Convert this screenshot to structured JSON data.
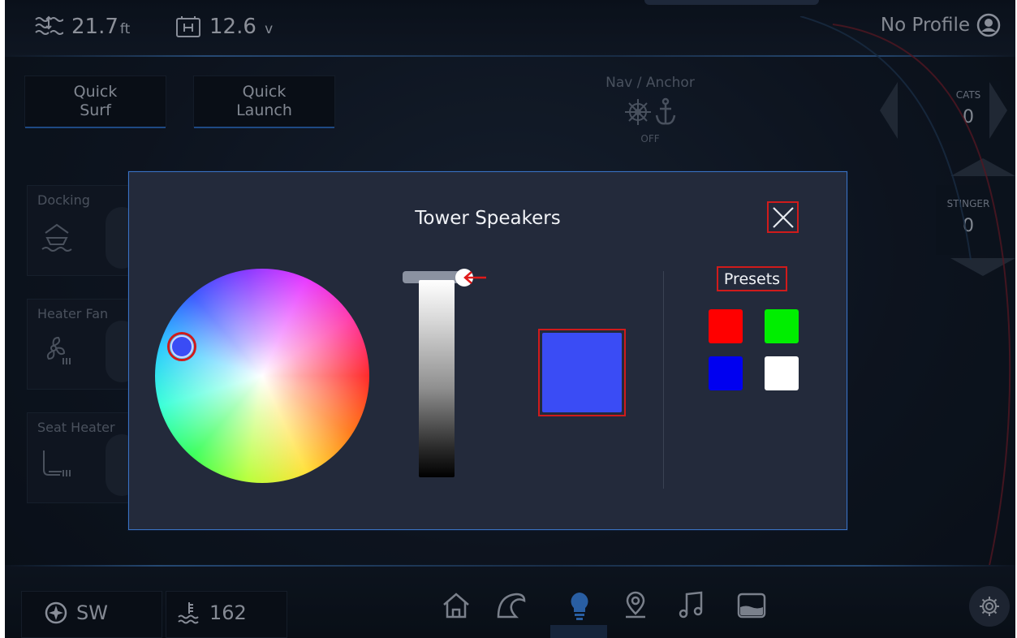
{
  "top_bar": {
    "depth_value": "21.7",
    "depth_unit": "ft",
    "depth_icon": "depth-waves-icon",
    "battery_value": "12.6",
    "battery_unit": "v",
    "battery_icon": "house-battery-icon",
    "profile_label": "No Profile",
    "profile_icon": "user-circle-icon"
  },
  "quick_buttons": [
    {
      "line1": "Quick",
      "line2": "Surf"
    },
    {
      "line1": "Quick",
      "line2": "Launch"
    }
  ],
  "nav_anchor": {
    "label": "Nav / Anchor",
    "state": "OFF",
    "icons": [
      "ship-wheel-icon",
      "anchor-icon"
    ]
  },
  "cats": {
    "label": "CATS",
    "value": "0"
  },
  "stinger": {
    "label": "STINGER",
    "value": "0"
  },
  "tiles": [
    {
      "label": "Docking",
      "icon": "boat-docking-icon"
    },
    {
      "label": "Heater Fan",
      "icon": "fan-heat-icon"
    },
    {
      "label": "Seat Heater",
      "icon": "seat-heat-icon"
    }
  ],
  "bottom_bar": {
    "heading_label": "SW",
    "heading_icon": "compass-icon",
    "water_temp_value": "162",
    "water_temp_icon": "water-temp-icon",
    "nav_items": [
      "home-icon",
      "wave-icon",
      "lightbulb-icon",
      "location-pin-icon",
      "music-note-icon",
      "ballast-tank-icon"
    ],
    "active_nav": "lightbulb-icon",
    "settings_icon": "gear-icon"
  },
  "modal": {
    "title": "Tower Speakers",
    "close_icon": "close-icon",
    "selected_color": "#3a4cf5",
    "brightness_percent": 100,
    "presets_label": "Presets",
    "presets": [
      {
        "color": "#ff0000",
        "name": "red"
      },
      {
        "color": "#00ee00",
        "name": "green"
      },
      {
        "color": "#0000f0",
        "name": "blue"
      },
      {
        "color": "#ffffff",
        "name": "white"
      }
    ]
  }
}
